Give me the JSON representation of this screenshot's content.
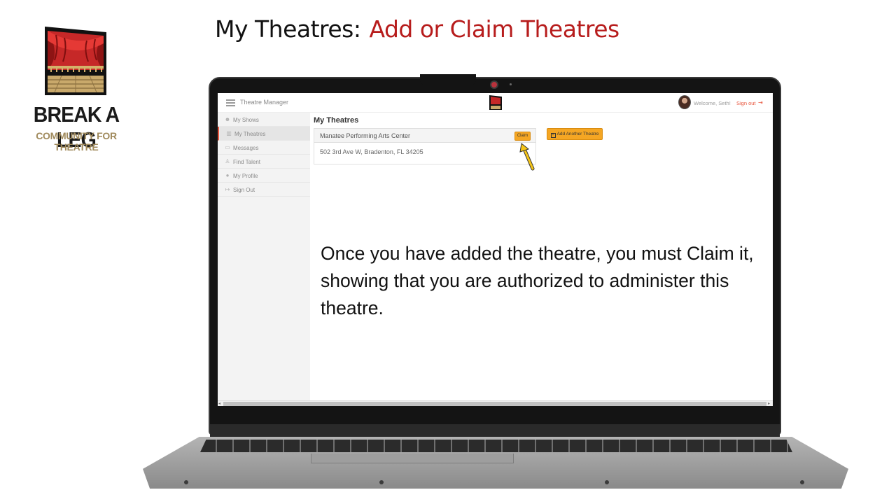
{
  "slide": {
    "title_main": "My Theatres:",
    "title_accent": "Add or Claim Theatres"
  },
  "logo": {
    "name": "BREAK A LEG",
    "tagline": "COMMUNITY FOR THEATRE"
  },
  "app": {
    "name": "Theatre Manager",
    "welcome": "Welcome, Seth!",
    "sign_out": "Sign out"
  },
  "sidebar": {
    "items": [
      {
        "label": "My Shows",
        "icon": "theatre-masks-icon"
      },
      {
        "label": "My Theatres",
        "icon": "theatre-building-icon",
        "active": true
      },
      {
        "label": "Messages",
        "icon": "chat-icon"
      },
      {
        "label": "Find Talent",
        "icon": "person-icon"
      },
      {
        "label": "My Profile",
        "icon": "user-circle-icon"
      },
      {
        "label": "Sign Out",
        "icon": "sign-out-icon"
      }
    ]
  },
  "main": {
    "heading": "My Theatres",
    "theatre": {
      "name": "Manatee Performing Arts Center",
      "address": "502 3rd Ave W, Bradenton, FL 34205",
      "claim_label": "Claim"
    },
    "add_label": "Add Another Theatre"
  },
  "instruction": "Once you have added the theatre, you must Claim it, showing that you are authorized to administer this theatre.",
  "colors": {
    "accent_red": "#b71c1c",
    "button_orange": "#f5a623",
    "signout_red": "#e8573f",
    "logo_gold": "#a08a5c"
  }
}
